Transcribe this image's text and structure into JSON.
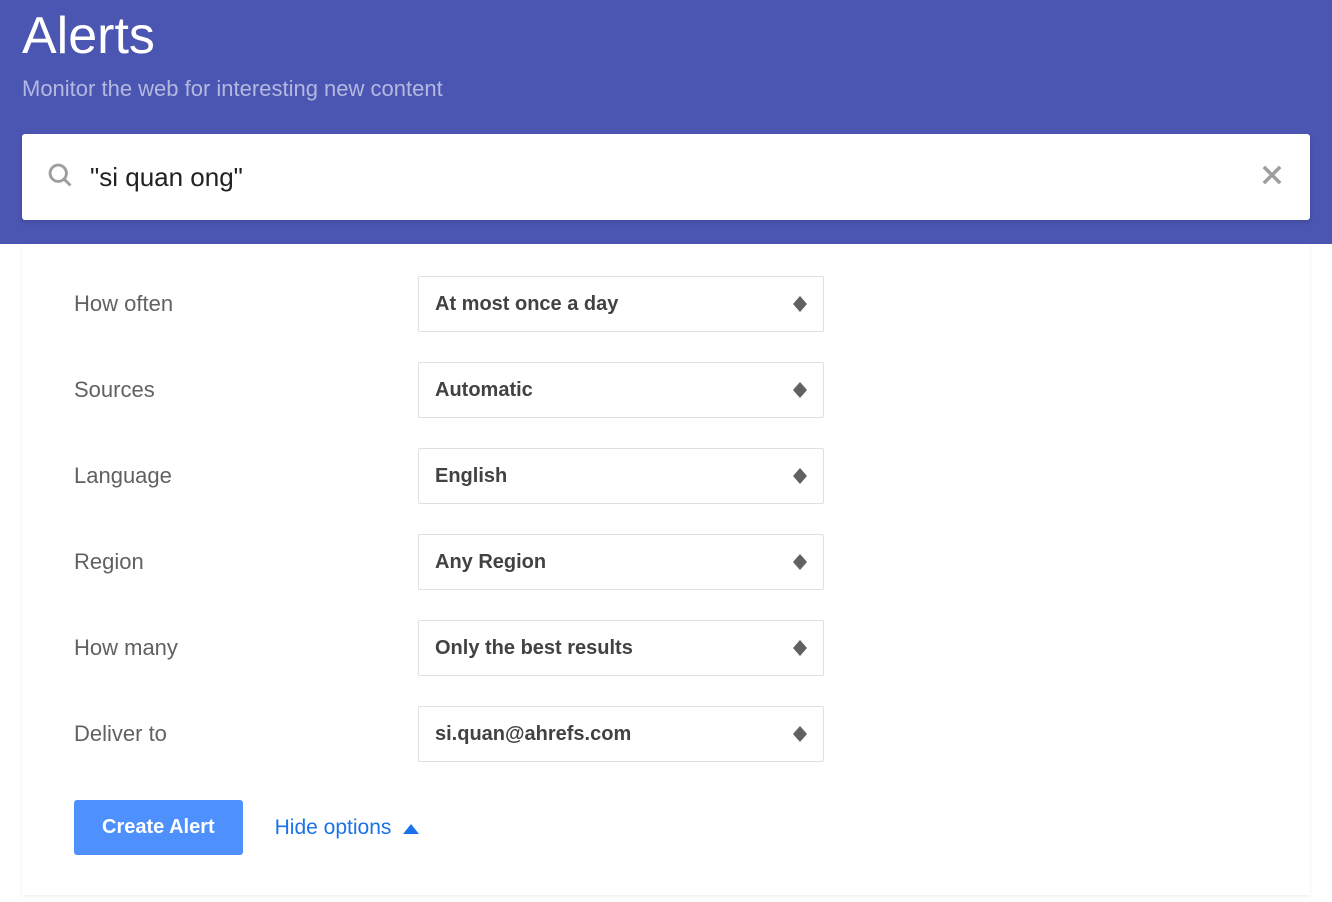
{
  "header": {
    "title": "Alerts",
    "subtitle": "Monitor the web for interesting new content"
  },
  "search": {
    "value": "\"si quan ong\""
  },
  "form": {
    "rows": [
      {
        "label": "How often",
        "value": "At most once a day"
      },
      {
        "label": "Sources",
        "value": "Automatic"
      },
      {
        "label": "Language",
        "value": "English"
      },
      {
        "label": "Region",
        "value": "Any Region"
      },
      {
        "label": "How many",
        "value": "Only the best results"
      },
      {
        "label": "Deliver to",
        "value": "si.quan@ahrefs.com"
      }
    ]
  },
  "actions": {
    "create_label": "Create Alert",
    "hide_options_label": "Hide options"
  }
}
